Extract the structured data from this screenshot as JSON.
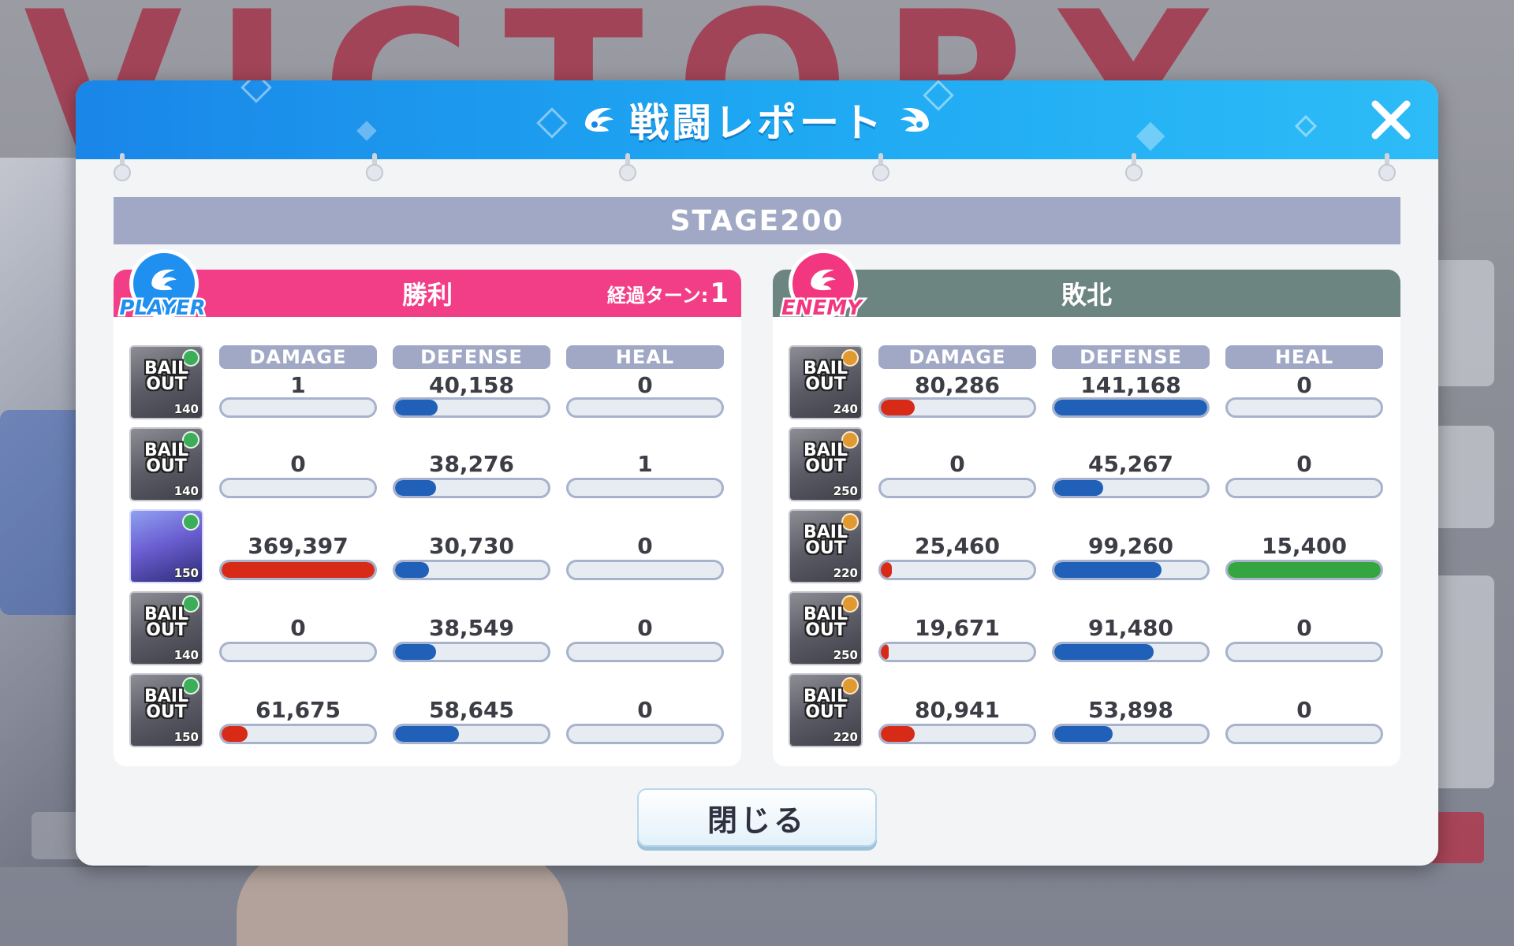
{
  "window": {
    "title": "戦闘レポート",
    "close_icon": "close-x-icon",
    "wing_icon": "wing-icon"
  },
  "background": {
    "title_text": "VICTORY"
  },
  "stage": {
    "label": "STAGE200"
  },
  "columns": [
    "DAMAGE",
    "DEFENSE",
    "HEAL"
  ],
  "colors": {
    "player_accent": "#f23e86",
    "enemy_accent": "#6d8580",
    "damage": "#d72a17",
    "defense": "#2060b8",
    "heal": "#35a541",
    "header_blue": "#1ea7f2"
  },
  "player": {
    "badge": "PLAYER",
    "result": "勝利",
    "turns_label": "経過ターン:",
    "turns_value": "1",
    "units": [
      {
        "status": "BAIL OUT",
        "level": "140",
        "damage": "1",
        "defense": "40,158",
        "heal": "0"
      },
      {
        "status": "BAIL OUT",
        "level": "140",
        "damage": "0",
        "defense": "38,276",
        "heal": "1"
      },
      {
        "status": "",
        "level": "150",
        "damage": "369,397",
        "defense": "30,730",
        "heal": "0"
      },
      {
        "status": "BAIL OUT",
        "level": "140",
        "damage": "0",
        "defense": "38,549",
        "heal": "0"
      },
      {
        "status": "BAIL OUT",
        "level": "150",
        "damage": "61,675",
        "defense": "58,645",
        "heal": "0"
      }
    ]
  },
  "enemy": {
    "badge": "ENEMY",
    "result": "敗北",
    "units": [
      {
        "status": "BAIL OUT",
        "level": "240",
        "damage": "80,286",
        "defense": "141,168",
        "heal": "0"
      },
      {
        "status": "BAIL OUT",
        "level": "250",
        "damage": "0",
        "defense": "45,267",
        "heal": "0"
      },
      {
        "status": "BAIL OUT",
        "level": "220",
        "damage": "25,460",
        "defense": "99,260",
        "heal": "15,400"
      },
      {
        "status": "BAIL OUT",
        "level": "250",
        "damage": "19,671",
        "defense": "91,480",
        "heal": "0"
      },
      {
        "status": "BAIL OUT",
        "level": "220",
        "damage": "80,941",
        "defense": "53,898",
        "heal": "0"
      }
    ]
  },
  "bar_fractions": {
    "player": [
      {
        "damage": 0.0,
        "defense": 0.28,
        "heal": 0.0
      },
      {
        "damage": 0.0,
        "defense": 0.27,
        "heal": 0.0
      },
      {
        "damage": 1.0,
        "defense": 0.22,
        "heal": 0.0
      },
      {
        "damage": 0.0,
        "defense": 0.27,
        "heal": 0.0
      },
      {
        "damage": 0.17,
        "defense": 0.42,
        "heal": 0.0
      }
    ],
    "enemy": [
      {
        "damage": 0.22,
        "defense": 1.0,
        "heal": 0.0
      },
      {
        "damage": 0.0,
        "defense": 0.32,
        "heal": 0.0
      },
      {
        "damage": 0.07,
        "defense": 0.7,
        "heal": 1.0
      },
      {
        "damage": 0.05,
        "defense": 0.65,
        "heal": 0.0
      },
      {
        "damage": 0.22,
        "defense": 0.38,
        "heal": 0.0
      }
    ]
  },
  "footer": {
    "close_button": "閉じる"
  }
}
